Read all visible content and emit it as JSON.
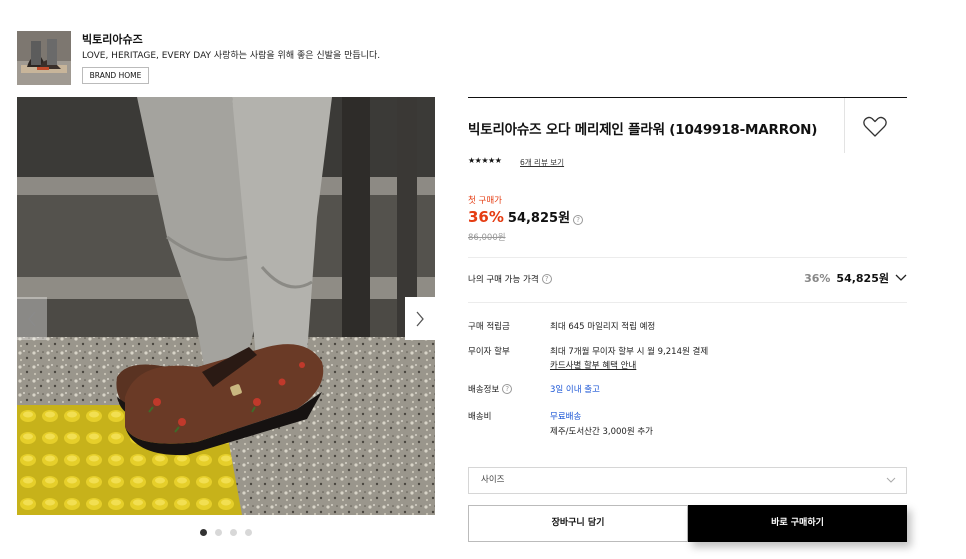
{
  "brand": {
    "name": "빅토리아슈즈",
    "description": "LOVE, HERITAGE, EVERY DAY 사랑하는 사람을 위해 좋은 신발을 만듭니다.",
    "home_button": "BRAND HOME"
  },
  "gallery": {
    "slide_count": 4,
    "active_slide": 1
  },
  "product": {
    "title": "빅토리아슈즈 오다 메리제인 플라워 (1049918-MARRON)",
    "stars": "★★★★★",
    "rating": 5,
    "review_link": "6개 리뷰 보기",
    "first_purchase_label": "첫 구매가",
    "discount_pct": "36%",
    "price": "54,825원",
    "original_price": "86,000원"
  },
  "my_price": {
    "label": "나의 구매 가능 가격",
    "discount_pct": "36%",
    "price": "54,825원"
  },
  "info": {
    "points_label": "구매 적립금",
    "points_value": "최대 645 마일리지 적립 예정",
    "installment_label": "무이자 할부",
    "installment_value": "최대 7개월 무이자 할부 시 월 9,214원 결제",
    "installment_link": "카드사별 할부 혜택 안내",
    "shipping_label": "배송정보",
    "shipping_value": "3일 이내 출고",
    "shipping_fee_label": "배송비",
    "shipping_fee_value": "무료배송",
    "shipping_fee_extra": "제주/도서산간 3,000원 추가"
  },
  "options": {
    "size_placeholder": "사이즈"
  },
  "actions": {
    "cart": "장바구니 담기",
    "buy": "바로 구매하기"
  },
  "colors": {
    "accent": "#e53c12",
    "link_blue": "#1a55d6",
    "buy_bg": "#000000"
  }
}
